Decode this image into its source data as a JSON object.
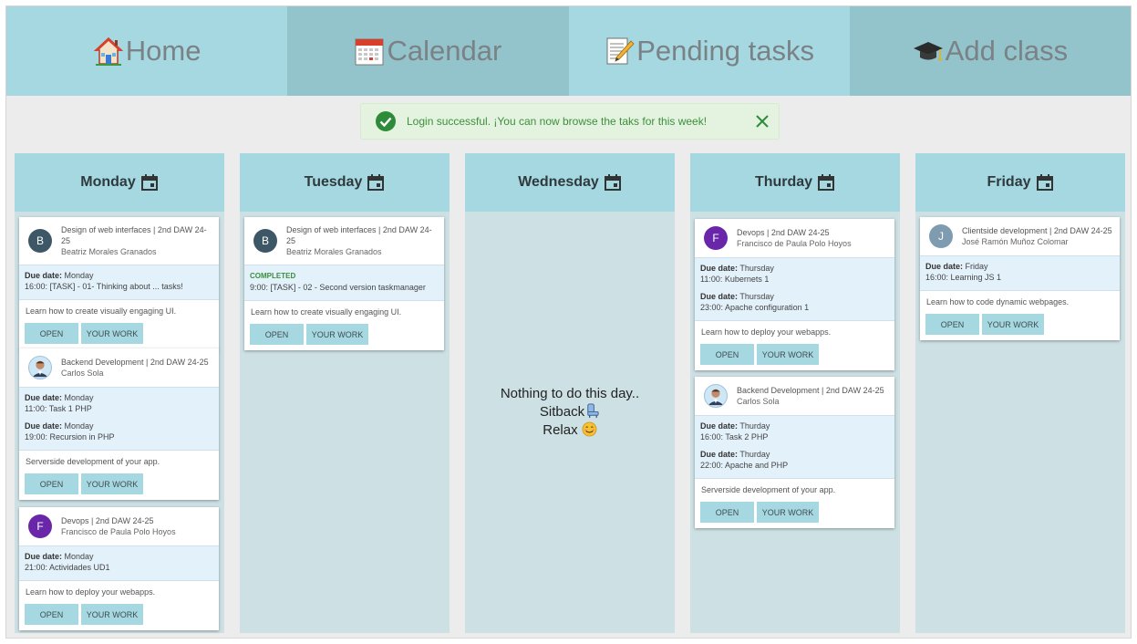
{
  "nav": {
    "tabs": [
      {
        "label": "Home",
        "icon": "house-icon"
      },
      {
        "label": "Calendar",
        "icon": "calendar-icon"
      },
      {
        "label": "Pending tasks",
        "icon": "memo-icon"
      },
      {
        "label": "Add class",
        "icon": "graduation-cap-icon"
      }
    ]
  },
  "alert": {
    "message": "Login successful. ¡You can now browse the taks for this week!",
    "icon": "check-circle-icon",
    "close_icon": "close-icon"
  },
  "colors": {
    "tab_light": "#a6d8e2",
    "tab_dark": "#93c3cb",
    "column_bg": "#cde0e4",
    "alert_text": "#3d8f3d",
    "completed": "#3a8f3a"
  },
  "labels": {
    "due_date": "Due date:",
    "completed": "COMPLETED",
    "open": "OPEN",
    "your_work": "YOUR WORK"
  },
  "days": [
    {
      "name": "Monday",
      "cards": [
        {
          "avatar": "B",
          "subject": "Design of web interfaces | 2nd DAW 24-25",
          "teacher": "Beatriz Morales Granados",
          "tasks": [
            {
              "due_day": "Monday",
              "task": "16:00: [TASK] - 01- Thinking about ... tasks!"
            }
          ],
          "description": "Learn how to create visually engaging UI."
        },
        {
          "avatar": "",
          "subject": "Backend Development | 2nd DAW 24-25",
          "teacher": "Carlos Sola",
          "tasks": [
            {
              "due_day": "Monday",
              "task": "11:00: Task 1 PHP"
            },
            {
              "due_day": "Monday",
              "task": "19:00: Recursion in PHP"
            }
          ],
          "description": "Serverside development of your app."
        },
        {
          "avatar": "F",
          "subject": "Devops | 2nd DAW 24-25",
          "teacher": "Francisco de Paula Polo Hoyos",
          "tasks": [
            {
              "due_day": "Monday",
              "task": "21:00: Actividades UD1"
            }
          ],
          "description": "Learn how to deploy your webapps."
        }
      ]
    },
    {
      "name": "Tuesday",
      "cards": [
        {
          "avatar": "B",
          "subject": "Design of web interfaces | 2nd DAW 24-25",
          "teacher": "Beatriz Morales Granados",
          "completed": true,
          "tasks": [
            {
              "task": "9:00: [TASK] - 02 - Second version taskmanager"
            }
          ],
          "description": "Learn how to create visually engaging UI."
        }
      ]
    },
    {
      "name": "Wednesday",
      "empty": {
        "line1": "Nothing to do this day..",
        "line2": "Sitback",
        "line3": "Relax"
      },
      "cards": []
    },
    {
      "name": "Thurday",
      "cards": [
        {
          "avatar": "F",
          "subject": "Devops | 2nd DAW 24-25",
          "teacher": "Francisco de Paula Polo Hoyos",
          "tasks": [
            {
              "due_day": "Thursday",
              "task": "11:00: Kubernets 1"
            },
            {
              "due_day": "Thursday",
              "task": "23:00: Apache configuration 1"
            }
          ],
          "description": "Learn how to deploy your webapps."
        },
        {
          "avatar": "",
          "subject": "Backend Development | 2nd DAW 24-25",
          "teacher": "Carlos Sola",
          "tasks": [
            {
              "due_day": "Thurday",
              "task": "16:00: Task 2 PHP"
            },
            {
              "due_day": "Thurday",
              "task": "22:00: Apache and PHP"
            }
          ],
          "description": "Serverside development of your app."
        }
      ]
    },
    {
      "name": "Friday",
      "cards": [
        {
          "avatar": "J",
          "subject": "Clientside development | 2nd DAW 24-25",
          "teacher": "José Ramón Muñoz Colomar",
          "tasks": [
            {
              "due_day": "Friday",
              "task": "16:00: Learning JS 1"
            }
          ],
          "description": "Learn how to code dynamic webpages."
        }
      ]
    }
  ]
}
